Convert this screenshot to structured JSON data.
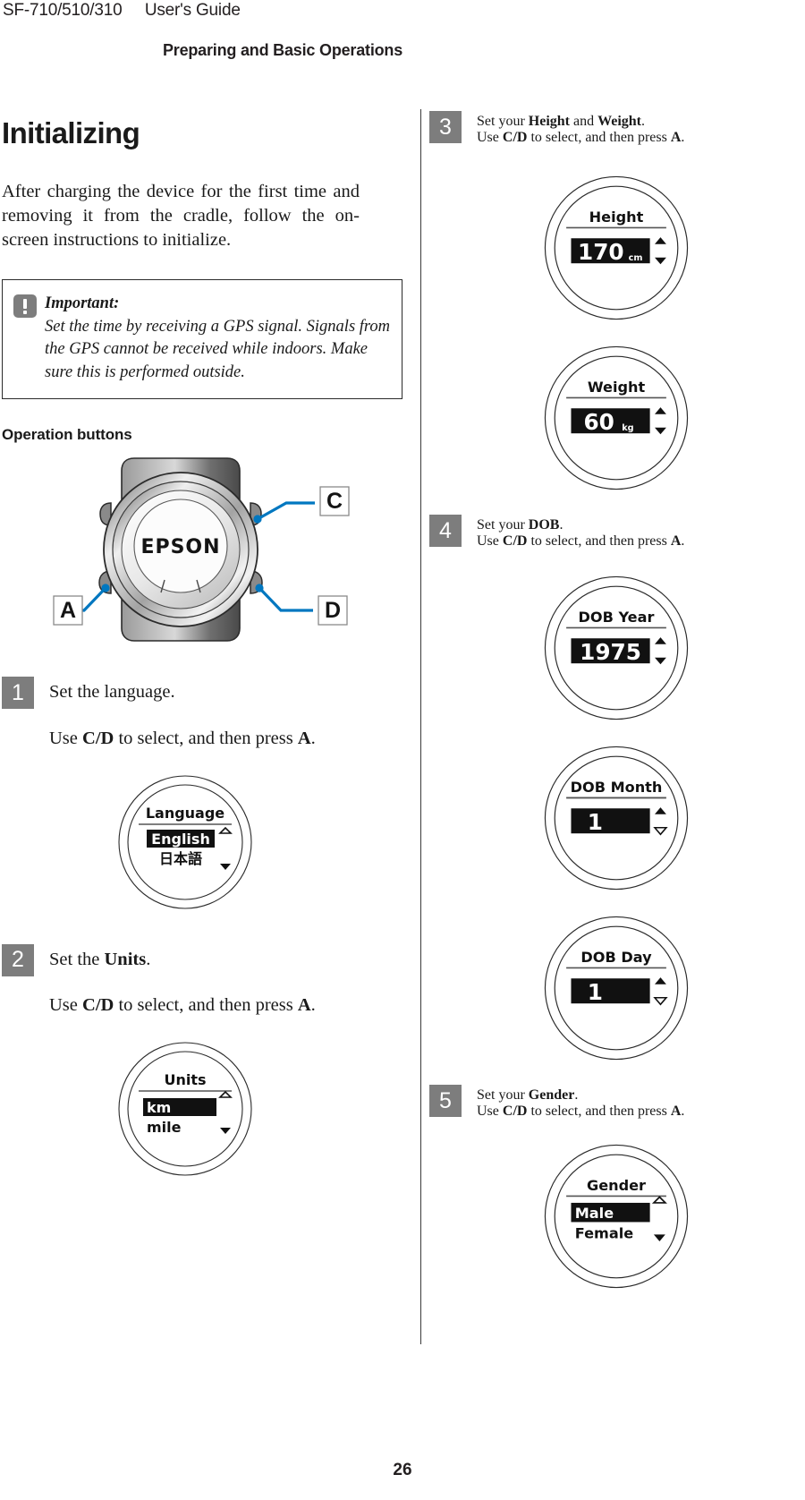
{
  "header": {
    "left": "SF-710/510/310     User's Guide",
    "section": "Preparing and Basic Operations"
  },
  "footer": {
    "page_number": "26"
  },
  "left_column": {
    "title": "Initializing",
    "intro": "After charging the device for the first time and removing it from the cradle, follow the on-screen instructions to initialize.",
    "note": {
      "icon": "important-exclamation-icon",
      "title": "Important:",
      "text": "Set the time by receiving a GPS signal. Signals from the GPS cannot be received while indoors. Make sure this is performed outside."
    },
    "operation_buttons": {
      "heading": "Operation buttons",
      "brand": "EPSON",
      "callouts": [
        {
          "label": "C",
          "position": "top-right"
        },
        {
          "label": "A",
          "position": "bottom-left"
        },
        {
          "label": "D",
          "position": "bottom-right"
        }
      ],
      "callout_color": "#0077c0"
    },
    "steps": [
      {
        "number": "1",
        "lead_prefix": "Set the language.",
        "lead_bold": "",
        "lead_suffix": "",
        "sub_parts": [
          "Use ",
          "C/D",
          " to select, and then press ",
          "A",
          "."
        ],
        "screen": {
          "title": "Language",
          "type": "list",
          "options": [
            "English",
            "日本語"
          ],
          "selected_index": 0,
          "up_arrow": "outline",
          "down_arrow": "filled"
        }
      },
      {
        "number": "2",
        "lead_prefix": "Set the ",
        "lead_bold": "Units",
        "lead_suffix": ".",
        "sub_parts": [
          "Use ",
          "C/D",
          " to select, and then press ",
          "A",
          "."
        ],
        "screen": {
          "title": "Units",
          "type": "list",
          "options": [
            "km",
            "mile"
          ],
          "selected_index": 0,
          "up_arrow": "outline",
          "down_arrow": "filled"
        }
      }
    ]
  },
  "right_column": {
    "steps": [
      {
        "number": "3",
        "lead_prefix": "Set your ",
        "lead_bold": "Height",
        "lead_mid": " and ",
        "lead_bold2": "Weight",
        "lead_suffix": ".",
        "sub_parts": [
          "Use ",
          "C/D",
          " to select, and then press ",
          "A",
          "."
        ],
        "screens": [
          {
            "title": "Height",
            "type": "value",
            "value": "170",
            "unit": "cm",
            "up_arrow": "filled",
            "down_arrow": "filled"
          },
          {
            "title": "Weight",
            "type": "value",
            "value": "60",
            "unit": "kg",
            "up_arrow": "filled",
            "down_arrow": "filled"
          }
        ]
      },
      {
        "number": "4",
        "lead_prefix": "Set your ",
        "lead_bold": "DOB",
        "lead_suffix": ".",
        "sub_parts": [
          "Use ",
          "C/D",
          " to select, and then press ",
          "A",
          "."
        ],
        "screens": [
          {
            "title": "DOB Year",
            "type": "value",
            "value": "1975",
            "unit": "",
            "up_arrow": "filled",
            "down_arrow": "filled"
          },
          {
            "title": "DOB Month",
            "type": "value",
            "value": "1",
            "unit": "",
            "up_arrow": "filled",
            "down_arrow": "outline"
          },
          {
            "title": "DOB Day",
            "type": "value",
            "value": "1",
            "unit": "",
            "up_arrow": "filled",
            "down_arrow": "outline"
          }
        ]
      },
      {
        "number": "5",
        "lead_prefix": "Set your ",
        "lead_bold": "Gender",
        "lead_suffix": ".",
        "sub_parts": [
          "Use ",
          "C/D",
          " to select, and then press ",
          "A",
          "."
        ],
        "screens": [
          {
            "title": "Gender",
            "type": "list",
            "options": [
              "Male",
              "Female"
            ],
            "selected_index": 0,
            "up_arrow": "outline",
            "down_arrow": "filled"
          }
        ]
      }
    ]
  }
}
